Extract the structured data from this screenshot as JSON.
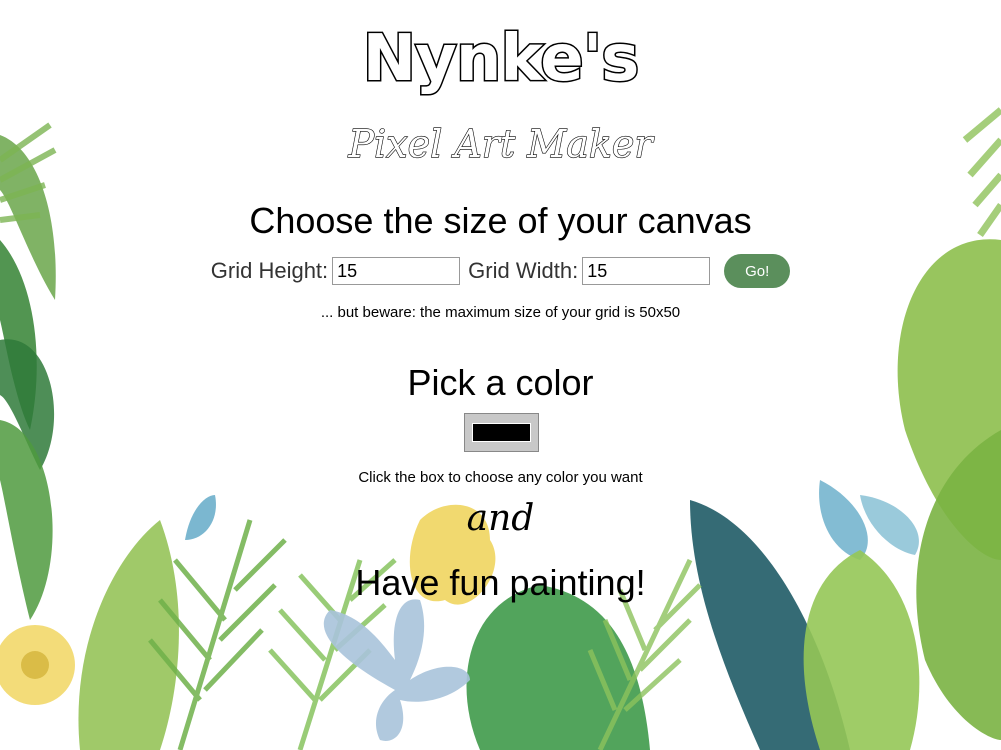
{
  "header": {
    "title": "Nynke's",
    "subtitle": "Pixel Art Maker"
  },
  "size_section": {
    "heading": "Choose the size of your canvas",
    "height_label": "Grid Height:",
    "height_value": "15",
    "width_label": "Grid Width:",
    "width_value": "15",
    "submit_label": "Go!",
    "note": "... but beware: the maximum size of your grid is 50x50"
  },
  "color_section": {
    "heading": "Pick a color",
    "selected_color": "#000000",
    "hint": "Click the box to choose any color you want"
  },
  "footer": {
    "and_text": "and",
    "closing": "Have fun painting!"
  },
  "colors": {
    "button_green": "#5b8f5c",
    "leaf_light": "#8dbf4c",
    "leaf_dark": "#3a7a3a",
    "leaf_teal": "#1f5b66",
    "flower_yellow": "#f2d86a",
    "flower_blue": "#a9c3da"
  }
}
